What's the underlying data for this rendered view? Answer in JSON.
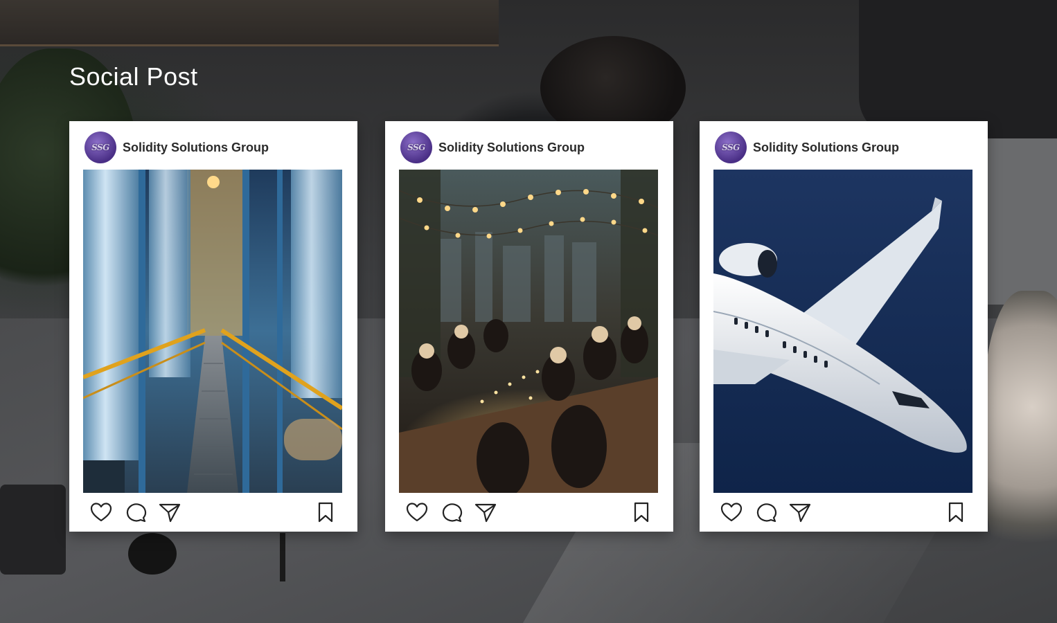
{
  "page": {
    "title": "Social Post"
  },
  "posts": [
    {
      "account_name": "Solidity Solutions Group",
      "avatar_text": "SSG",
      "image": "industrial-plant-walkway-photo"
    },
    {
      "account_name": "Solidity Solutions Group",
      "avatar_text": "SSG",
      "image": "rooftop-dinner-party-photo"
    },
    {
      "account_name": "Solidity Solutions Group",
      "avatar_text": "SSG",
      "image": "private-jet-over-ocean-photo"
    }
  ],
  "icons": {
    "like": "heart-icon",
    "comment": "speech-bubble-icon",
    "share": "paper-plane-icon",
    "save": "bookmark-icon"
  },
  "colors": {
    "brand": "#5b3a9c",
    "card": "#ffffff",
    "title": "#ffffff",
    "icon_stroke": "#222222"
  }
}
